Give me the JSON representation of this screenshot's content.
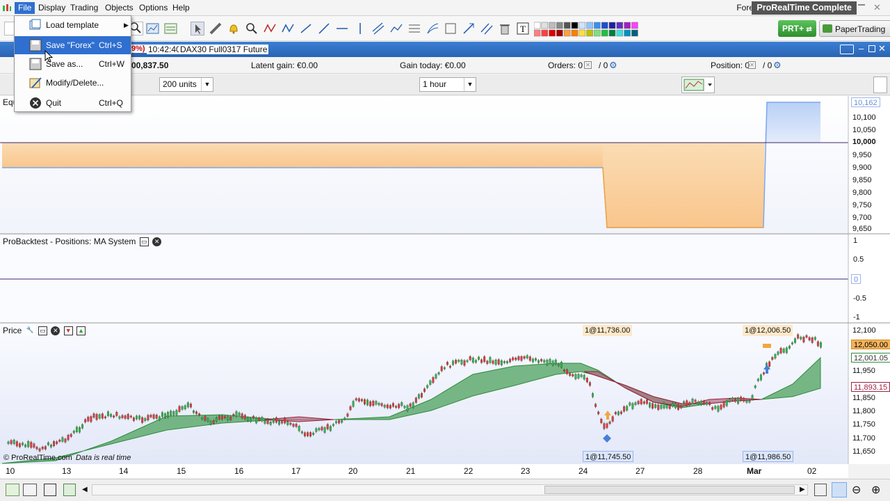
{
  "menubar": {
    "items": [
      "File",
      "Display",
      "Trading",
      "Objects",
      "Options",
      "Help"
    ],
    "market": "Forex",
    "app_title": "ProRealTime Complete"
  },
  "toolbar": {
    "prt_button": "PRT+",
    "paper_button": "PaperTrading"
  },
  "file_menu": {
    "items": [
      {
        "label": "Load template",
        "shortcut": ""
      },
      {
        "label": "Save \"Forex\"",
        "shortcut": "Ctrl+S"
      },
      {
        "label": "Save as...",
        "shortcut": "Ctrl+W"
      },
      {
        "label": "Modify/Delete...",
        "shortcut": ""
      },
      {
        "label": "Quit",
        "shortcut": "Ctrl+Q"
      }
    ]
  },
  "titlebar": {
    "pct": "9%)",
    "time": "10:42:40",
    "instrument": "DAX30 Full0317 Future"
  },
  "infobar": {
    "equity": "00,837.50",
    "latent_gain": "Latent gain: €0.00",
    "gain_today": "Gain today: €0.00",
    "orders_label": "Orders: 0",
    "orders_sep": "/ 0",
    "position_label": "Position: 0",
    "position_sep": "/ 0"
  },
  "selectors": {
    "units": "200 units",
    "timeframe": "1 hour"
  },
  "equity_panel": {
    "title": "Equ",
    "ticks": [
      "10,100",
      "10,050",
      "9,950",
      "9,900",
      "9,850",
      "9,800",
      "9,750",
      "9,700",
      "9,650"
    ],
    "top_tag": "10,162",
    "mid_tag": "10,000"
  },
  "positions_panel": {
    "title": "ProBacktest - Positions: MA System",
    "ticks": [
      "1",
      "0.5",
      "-0.5",
      "-1"
    ],
    "zero_tag": "0"
  },
  "price_panel": {
    "title": "Price",
    "ticks": [
      "12,100",
      "11,950",
      "11,850",
      "11,800",
      "11,750",
      "11,700",
      "11,650"
    ],
    "tag_last": "12,050.00",
    "tag_ma1": "12,001.05",
    "tag_ma2": "11,893.15",
    "label_high1": "1@11,736.00",
    "label_high2": "1@12,006.50",
    "label_low1": "1@11,745.50",
    "label_low2": "1@11,986.50",
    "copyright": "© ProRealTime.com",
    "realtime_note": "Data is real time"
  },
  "xaxis": {
    "labels": [
      "10",
      "13",
      "14",
      "15",
      "16",
      "17",
      "20",
      "21",
      "22",
      "23",
      "24",
      "27",
      "28",
      "Mar",
      "02"
    ]
  },
  "colors": {
    "menu_highlight": "#2f6fd0",
    "titlebar": "#2f6fd0",
    "equity_orange": "#f5b35a",
    "equity_blue": "#7aa7ee",
    "ma_green": "#2e8b3e",
    "ma_red": "#9c2040",
    "candle_up": "#2fb84a",
    "candle_down": "#e03a3a"
  }
}
